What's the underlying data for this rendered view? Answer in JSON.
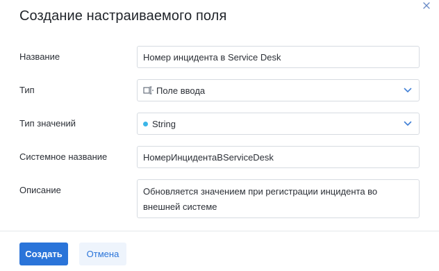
{
  "dialog": {
    "title": "Создание настраиваемого поля",
    "close_icon": "close-icon"
  },
  "form": {
    "name": {
      "label": "Название",
      "value": "Номер инцидента в Service Desk"
    },
    "type": {
      "label": "Тип",
      "value": "Поле ввода",
      "icon": "input-field-icon"
    },
    "value_type": {
      "label": "Тип значений",
      "value": "String",
      "dot_color": "#3bb6e8"
    },
    "system_name": {
      "label": "Системное название",
      "value": "НомерИнцидентаВServiceDesk"
    },
    "description": {
      "label": "Описание",
      "value": "Обновляется значением при регистрации инцидента во внешней системе"
    }
  },
  "footer": {
    "create_label": "Создать",
    "cancel_label": "Отмена"
  },
  "colors": {
    "primary": "#2a74d9",
    "link": "#2a74d9",
    "cancel_bg": "#eef4fc",
    "chevron": "#3f7fd6"
  }
}
